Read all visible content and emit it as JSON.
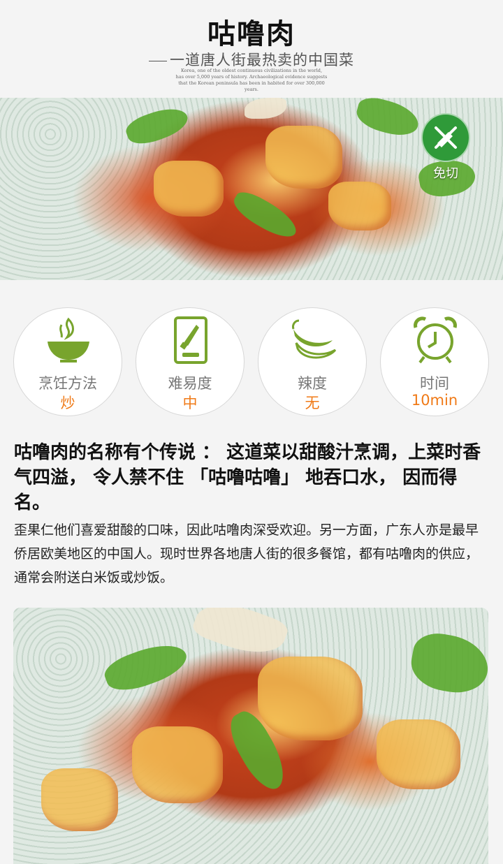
{
  "header": {
    "title": "咕噜肉",
    "subtitle": "一道唐人街最热卖的中国菜",
    "english_lines": [
      "Korea, one of the oldest continuous civilizations in the world,",
      "has over 5,000 years of history. Archaeological evidence suggests",
      "that the Korean peninsula has been in habited  for over 300,000 years."
    ]
  },
  "badge": {
    "icon": "knife-cross-icon",
    "label": "免切",
    "color": "#2f9a39"
  },
  "features": [
    {
      "icon": "bowl-flame-icon",
      "label": "烹饪方法",
      "value": "炒"
    },
    {
      "icon": "cutting-board-knife-icon",
      "label": "难易度",
      "value": "中"
    },
    {
      "icon": "chili-pepper-icon",
      "label": "辣度",
      "value": "无"
    },
    {
      "icon": "alarm-clock-icon",
      "label": "时间",
      "value": "10min"
    }
  ],
  "colors": {
    "icon_green": "#78a42d",
    "value_orange": "#f07a17",
    "label_gray": "#777777"
  },
  "description": {
    "headline": "咕噜肉的名称有个传说 ： 这道菜以甜酸汁烹调，上菜时香气四溢， 令人禁不住 「咕噜咕噜」 地吞口水， 因而得名。",
    "body": "歪果仁他们喜爱甜酸的口味，因此咕噜肉深受欢迎。另一方面，广东人亦是最早侨居欧美地区的中国人。现时世界各地唐人街的很多餐馆，都有咕噜肉的供应，通常会附送白米饭或炒饭。"
  }
}
